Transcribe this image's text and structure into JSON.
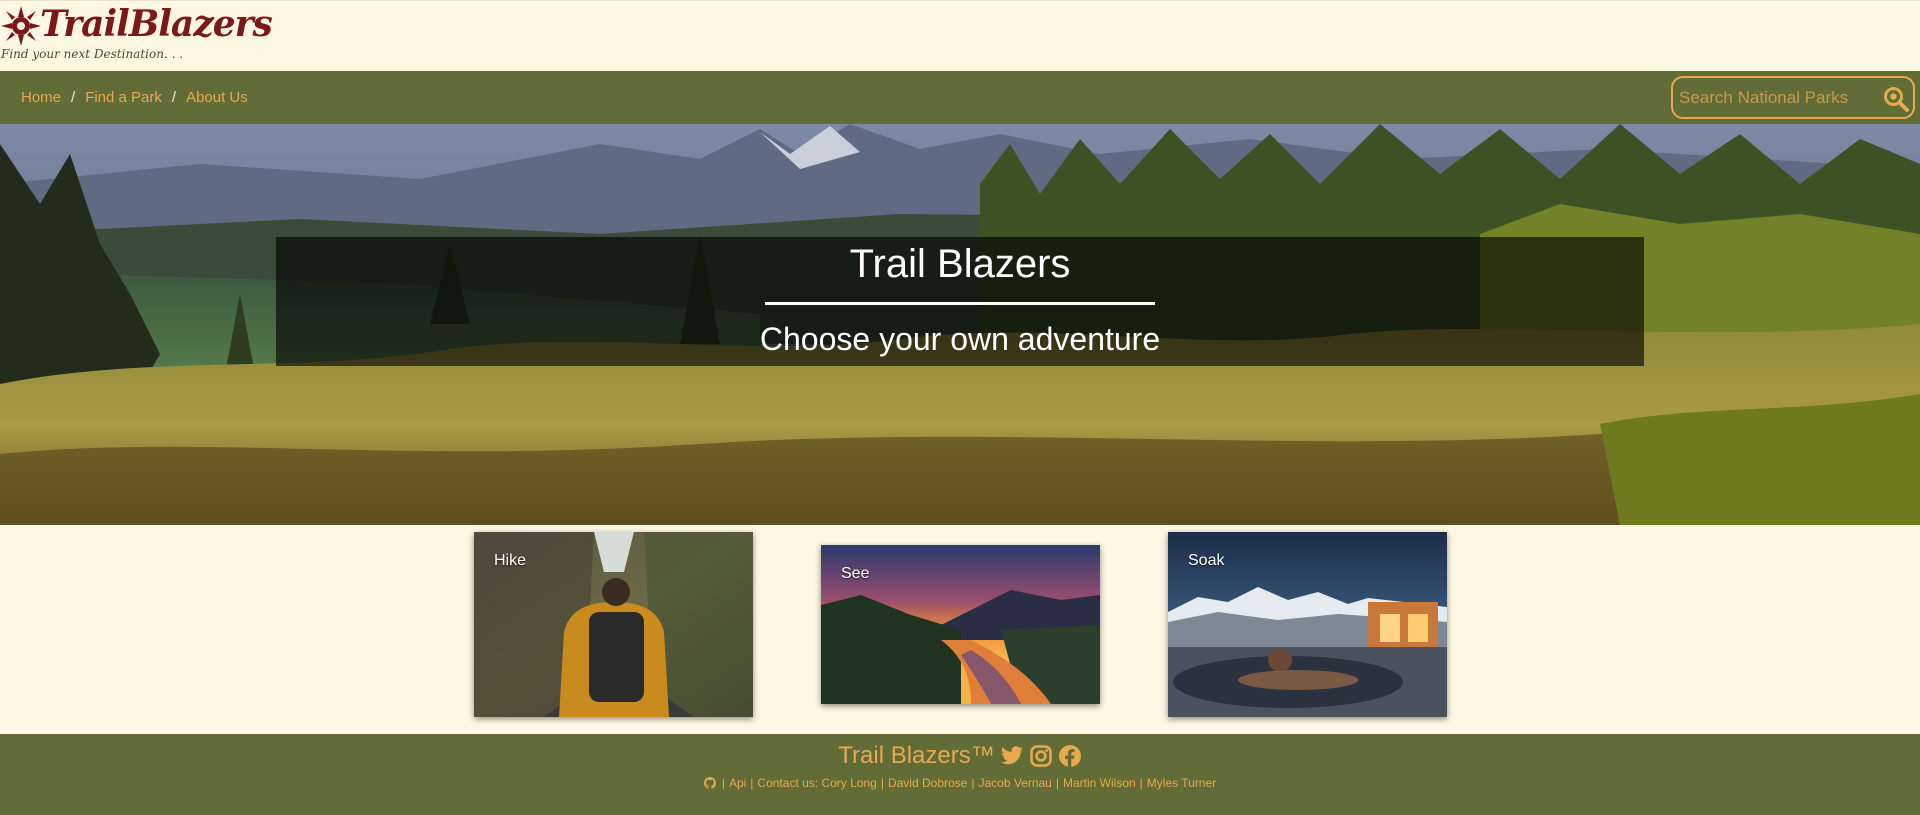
{
  "brand": {
    "title": "TrailBlazers",
    "tagline": "Find your next Destination. . ."
  },
  "nav": {
    "breadcrumb": [
      "Home",
      "Find a Park",
      "About Us"
    ],
    "separator": "/"
  },
  "search": {
    "placeholder": "Search National Parks",
    "value": "",
    "icon": "search-icon"
  },
  "hero": {
    "title": "Trail Blazers",
    "subtitle": "Choose your own adventure"
  },
  "cards": [
    {
      "label": "Hike"
    },
    {
      "label": "See"
    },
    {
      "label": "Soak"
    }
  ],
  "footer": {
    "brand": "Trail Blazers™",
    "social_icons": [
      "twitter-icon",
      "instagram-icon",
      "facebook-icon"
    ],
    "links": {
      "api": "Api",
      "contact_prefix": "Contact us:",
      "contacts": [
        "Cory Long",
        "David Dobrose",
        "Jacob Vernau",
        "Martin Wilson",
        "Myles Turner"
      ],
      "separator": "|"
    }
  },
  "colors": {
    "background": "#fdf8e3",
    "bar_green": "#616c37",
    "accent_orange": "#e9a94e",
    "logo_red": "#7c1818"
  }
}
